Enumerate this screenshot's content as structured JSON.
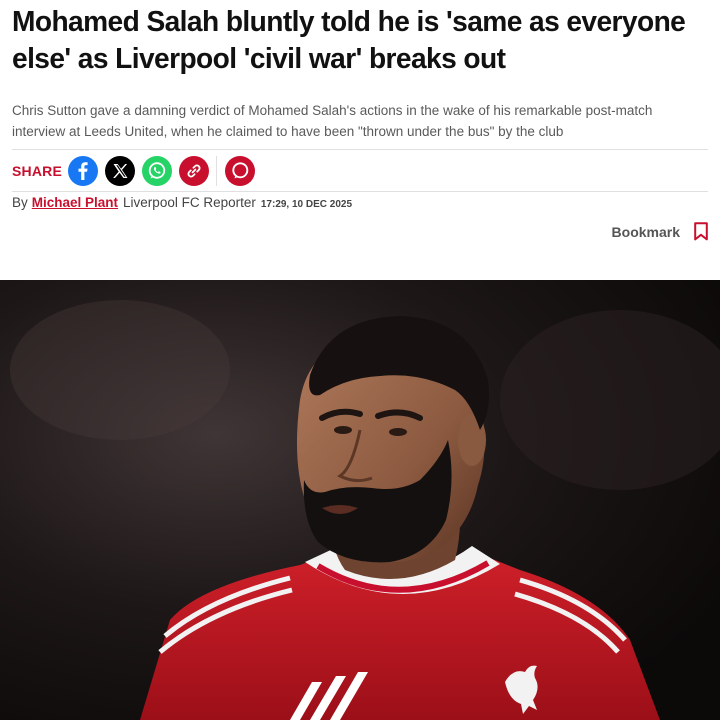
{
  "article": {
    "headline": "Mohamed Salah bluntly told he is 'same as everyone else' as Liverpool 'civil war' breaks out",
    "standfirst": "Chris Sutton gave a damning verdict of Mohamed Salah's actions in the wake of his remarkable post-match interview at Leeds United, when he claimed to have been \"thrown under the bus\" by the club"
  },
  "share": {
    "label": "SHARE",
    "buttons": [
      {
        "name": "facebook",
        "icon": "facebook-icon",
        "color": "#1877f2"
      },
      {
        "name": "x",
        "icon": "x-icon",
        "color": "#000000"
      },
      {
        "name": "whatsapp",
        "icon": "whatsapp-icon",
        "color": "#25d366"
      },
      {
        "name": "copy-link",
        "icon": "link-icon",
        "color": "#c8102e"
      }
    ],
    "comments_icon": "comment-icon"
  },
  "byline": {
    "prefix": "By",
    "author": "Michael Plant",
    "role": "Liverpool FC Reporter",
    "timestamp": "17:29, 10 DEC 2025"
  },
  "bookmark": {
    "label": "Bookmark",
    "icon": "bookmark-icon"
  },
  "hero_image": {
    "kit_color": "#c8102e",
    "crest_icon": "liver-bird-icon"
  },
  "colors": {
    "accent": "#c8102e",
    "text": "#111111",
    "muted": "#5a5a5a"
  }
}
